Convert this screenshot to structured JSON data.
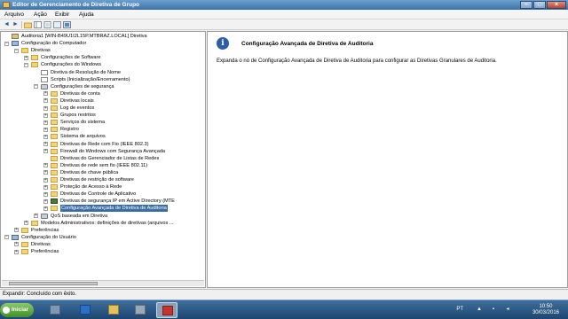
{
  "window": {
    "title": "Editor de Gerenciamento de Diretiva de Grupo",
    "min_label": "–",
    "max_label": "□",
    "close_label": "×"
  },
  "menu": [
    "Arquivo",
    "Ação",
    "Exibir",
    "Ajuda"
  ],
  "toolbar": {
    "back_label": "◄",
    "forward_label": "►",
    "up_label": "▣",
    "icons": [
      "back-icon",
      "forward-icon",
      "up-folder-icon",
      "show-hide-tree-icon",
      "properties-icon",
      "help-icon",
      "view-icon"
    ]
  },
  "tree": [
    {
      "label": "Auditoria1 [WIN-B49U1I2L15P.MTBRAZ.LOCAL] Diretiva",
      "level": 0,
      "icon": "root",
      "exp": "",
      "name": "tree-item-policy-root"
    },
    {
      "label": "Configuração do Computador",
      "level": 0,
      "icon": "comp",
      "exp": "−",
      "name": "tree-item-computer-config"
    },
    {
      "label": "Diretivas",
      "level": 1,
      "icon": "folder",
      "exp": "−",
      "name": "tree-item-policies"
    },
    {
      "label": "Configurações de Software",
      "level": 2,
      "icon": "folder",
      "exp": "+",
      "name": "tree-item-software-settings"
    },
    {
      "label": "Configurações do Windows",
      "level": 2,
      "icon": "folder",
      "exp": "−",
      "name": "tree-item-windows-settings"
    },
    {
      "label": "Diretiva de Resolução de Nome",
      "level": 3,
      "icon": "doc",
      "exp": "",
      "name": "tree-item-name-resolution"
    },
    {
      "label": "Scripts (Inicialização/Encerramento)",
      "level": 3,
      "icon": "doc",
      "exp": "",
      "name": "tree-item-scripts"
    },
    {
      "label": "Configurações de segurança",
      "level": 3,
      "icon": "gear",
      "exp": "−",
      "name": "tree-item-security-settings"
    },
    {
      "label": "Diretivas de conta",
      "level": 4,
      "icon": "folder",
      "exp": "+",
      "name": "tree-item-account-policies"
    },
    {
      "label": "Diretivas locais",
      "level": 4,
      "icon": "folder",
      "exp": "+",
      "name": "tree-item-local-policies"
    },
    {
      "label": "Log de eventos",
      "level": 4,
      "icon": "folder",
      "exp": "+",
      "name": "tree-item-event-log"
    },
    {
      "label": "Grupos restritos",
      "level": 4,
      "icon": "folder",
      "exp": "+",
      "name": "tree-item-restricted-groups"
    },
    {
      "label": "Serviços do sistema",
      "level": 4,
      "icon": "folder",
      "exp": "+",
      "name": "tree-item-system-services"
    },
    {
      "label": "Registro",
      "level": 4,
      "icon": "folder",
      "exp": "+",
      "name": "tree-item-registry"
    },
    {
      "label": "Sistema de arquivos",
      "level": 4,
      "icon": "folder",
      "exp": "+",
      "name": "tree-item-file-system"
    },
    {
      "label": "Diretivas de Rede com Fio (IEEE 802.3)",
      "level": 4,
      "icon": "folder",
      "exp": "+",
      "name": "tree-item-wired-network"
    },
    {
      "label": "Firewall do Windows com Segurança Avançada",
      "level": 4,
      "icon": "folder",
      "exp": "+",
      "name": "tree-item-firewall"
    },
    {
      "label": "Diretivas do Gerenciador de Listas de Redes",
      "level": 4,
      "icon": "folder",
      "exp": "",
      "name": "tree-item-network-list"
    },
    {
      "label": "Diretivas de rede sem fio (IEEE 802.11)",
      "level": 4,
      "icon": "folder",
      "exp": "+",
      "name": "tree-item-wireless-network"
    },
    {
      "label": "Diretivas de chave pública",
      "level": 4,
      "icon": "folder",
      "exp": "+",
      "name": "tree-item-public-key"
    },
    {
      "label": "Diretivas de restrição de software",
      "level": 4,
      "icon": "folder",
      "exp": "+",
      "name": "tree-item-software-restriction"
    },
    {
      "label": "Proteção de Acesso à Rede",
      "level": 4,
      "icon": "folder",
      "exp": "+",
      "name": "tree-item-nap"
    },
    {
      "label": "Diretivas de Controle de Aplicativo",
      "level": 4,
      "icon": "folder",
      "exp": "+",
      "name": "tree-item-app-control"
    },
    {
      "label": "Diretivas de segurança IP em Active Directory (MTE",
      "level": 4,
      "icon": "shield",
      "exp": "+",
      "name": "tree-item-ipsec"
    },
    {
      "label": "Configuração Avançada de Diretiva de Auditoria",
      "level": 4,
      "icon": "folder",
      "exp": "+",
      "name": "tree-item-advanced-audit",
      "selected": true
    },
    {
      "label": "QoS baseada em Diretiva",
      "level": 3,
      "icon": "gear",
      "exp": "+",
      "name": "tree-item-qos"
    },
    {
      "label": "Modelos Administrativos: definições de diretivas (arquivos ...",
      "level": 2,
      "icon": "folder",
      "exp": "+",
      "name": "tree-item-admin-templates"
    },
    {
      "label": "Preferências",
      "level": 1,
      "icon": "folder",
      "exp": "+",
      "name": "tree-item-computer-preferences"
    },
    {
      "label": "Configuração do Usuário",
      "level": 0,
      "icon": "comp",
      "exp": "−",
      "name": "tree-item-user-config"
    },
    {
      "label": "Diretivas",
      "level": 1,
      "icon": "folder",
      "exp": "+",
      "name": "tree-item-user-policies"
    },
    {
      "label": "Preferências",
      "level": 1,
      "icon": "folder",
      "exp": "+",
      "name": "tree-item-user-preferences"
    }
  ],
  "right": {
    "info_glyph": "i",
    "title": "Configuração Avançada de Diretiva de Auditoria",
    "description": "Expanda o nó de Configuração Avançada de Diretiva de Auditoria para configurar as Diretivas Granulares de Auditoria."
  },
  "status": {
    "text": "Expandir: Concluído com êxito."
  },
  "taskbar": {
    "start_label": "Iniciar",
    "apps": [
      {
        "name": "taskbar-server-manager",
        "icon": "server-manager-icon",
        "color": "#7f98b6"
      },
      {
        "name": "taskbar-powershell",
        "icon": "powershell-icon",
        "color": "#2a6fc9"
      },
      {
        "name": "taskbar-explorer",
        "icon": "folder-icon",
        "color": "#e6c25a"
      },
      {
        "name": "taskbar-gpmc",
        "icon": "group-policy-icon",
        "color": "#9aa9b8"
      },
      {
        "name": "taskbar-gp-editor",
        "icon": "group-policy-editor-icon",
        "color": "#c7342a",
        "active": true
      }
    ],
    "lang": "PT",
    "time": "10:50",
    "date": "30/03/2016"
  }
}
